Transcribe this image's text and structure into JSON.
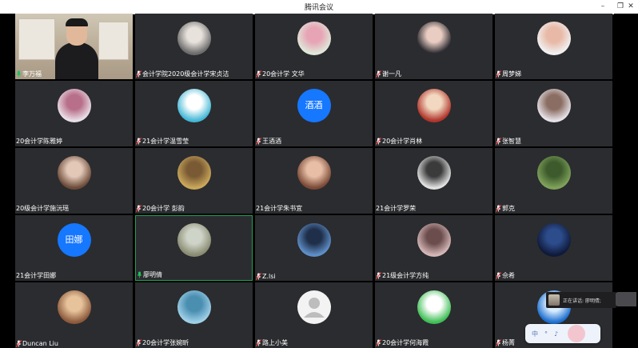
{
  "window": {
    "title": "腾讯会议",
    "controls": [
      "–",
      "❐",
      "✕"
    ]
  },
  "participants": [
    {
      "name": "李万福",
      "mic": "on",
      "type": "video"
    },
    {
      "name": "会计学院2020级会计学宋贞洁",
      "mic": "muted",
      "type": "photo",
      "c1": "#6d6d6d",
      "c2": "#e8e2dc"
    },
    {
      "name": "20会计学 文华",
      "mic": "muted",
      "type": "photo",
      "c1": "#dfe8d9",
      "c2": "#e7a4b5"
    },
    {
      "name": "谢一凡",
      "mic": "muted",
      "type": "photo",
      "c1": "#2b2b31",
      "c2": "#e9cdc2"
    },
    {
      "name": "周梦娣",
      "mic": "muted",
      "type": "photo",
      "c1": "#f1f1f1",
      "c2": "#e8b9a7"
    },
    {
      "name": "20会计学陈雅婷",
      "mic": "none",
      "type": "photo",
      "c1": "#e9dfe6",
      "c2": "#b86f8a"
    },
    {
      "name": "21会计学温雪莹",
      "mic": "muted",
      "type": "photo",
      "c1": "#45b8d6",
      "c2": "#ffffff"
    },
    {
      "name": "王酒酒",
      "mic": "muted",
      "type": "text",
      "text": "酒酒"
    },
    {
      "name": "20会计学肖林",
      "mic": "muted",
      "type": "photo",
      "c1": "#b1362c",
      "c2": "#f2d8c0"
    },
    {
      "name": "张智慧",
      "mic": "muted",
      "type": "photo",
      "c1": "#e6e2e8",
      "c2": "#8b6e63"
    },
    {
      "name": "20级会计学施沅瑶",
      "mic": "none",
      "type": "photo",
      "c1": "#6c4b39",
      "c2": "#e3c8b8"
    },
    {
      "name": "20会计学 彭韵",
      "mic": "muted",
      "type": "photo",
      "c1": "#caa85b",
      "c2": "#7a5a34"
    },
    {
      "name": "21会计学朱书宜",
      "mic": "none",
      "type": "photo",
      "c1": "#7b4a37",
      "c2": "#e8bfa6"
    },
    {
      "name": "21会计学罗荣",
      "mic": "none",
      "type": "photo",
      "c1": "#e2e2e2",
      "c2": "#3b3b3b"
    },
    {
      "name": "郭克",
      "mic": "muted",
      "type": "photo",
      "c1": "#7fa25a",
      "c2": "#3c5a2c"
    },
    {
      "name": "21会计学田娜",
      "mic": "none",
      "type": "text",
      "text": "田娜"
    },
    {
      "name": "廖明倩",
      "mic": "on",
      "type": "photo",
      "speaking": true,
      "c1": "#8a8c72",
      "c2": "#cfd4c8"
    },
    {
      "name": "Z.lsi",
      "mic": "muted",
      "type": "photo",
      "c1": "#5f8fc8",
      "c2": "#1f2f4a"
    },
    {
      "name": "21级会计学方纯",
      "mic": "muted",
      "type": "photo",
      "c1": "#d5b7b7",
      "c2": "#6b4d4d"
    },
    {
      "name": "佘希",
      "mic": "muted",
      "type": "photo",
      "c1": "#0f1a3a",
      "c2": "#2d4c8c"
    },
    {
      "name": "Duncan Liu",
      "mic": "muted",
      "type": "photo",
      "c1": "#8d5a3c",
      "c2": "#e7c39b"
    },
    {
      "name": "20会计学张婉昕",
      "mic": "muted",
      "type": "photo",
      "c1": "#9fd0e8",
      "c2": "#4a8eb0"
    },
    {
      "name": "路上小美",
      "mic": "muted",
      "type": "default"
    },
    {
      "name": "20会计学何海霞",
      "mic": "muted",
      "type": "photo",
      "c1": "#3fbf56",
      "c2": "#ffffff"
    },
    {
      "name": "杨菁",
      "mic": "muted",
      "type": "photo",
      "c1": "#1d6fd0",
      "c2": "#d8ecff"
    }
  ],
  "speaker_panel": {
    "label": "正在讲话: 廖明倩;"
  },
  "float_toolbar": {
    "items": [
      "中",
      "°",
      "♪"
    ]
  }
}
